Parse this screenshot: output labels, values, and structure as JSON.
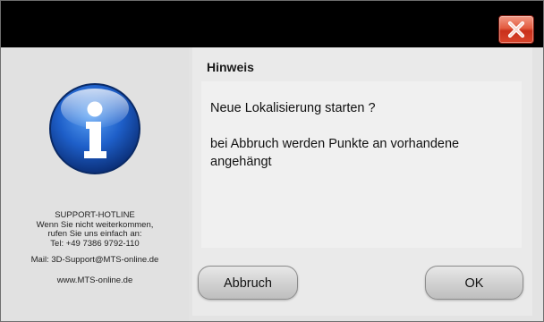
{
  "titlebar": {
    "close_icon": "close-x-icon",
    "close_color": "#d9452c"
  },
  "sidebar": {
    "icon": "info-icon",
    "icon_color": "#1b53b8",
    "support": {
      "title": "SUPPORT-HOTLINE",
      "line1": "Wenn Sie nicht weiterkommen,",
      "line2": "rufen Sie uns einfach an:",
      "phone": "Tel: +49 7386 9792-110",
      "mail": "Mail: 3D-Support@MTS-online.de",
      "web": "www.MTS-online.de"
    }
  },
  "dialog": {
    "heading": "Hinweis",
    "message_line1": "Neue Lokalisierung starten ?",
    "message_line2": "bei Abbruch werden Punkte an vorhandene angehängt"
  },
  "buttons": {
    "cancel_label": "Abbruch",
    "ok_label": "OK"
  }
}
